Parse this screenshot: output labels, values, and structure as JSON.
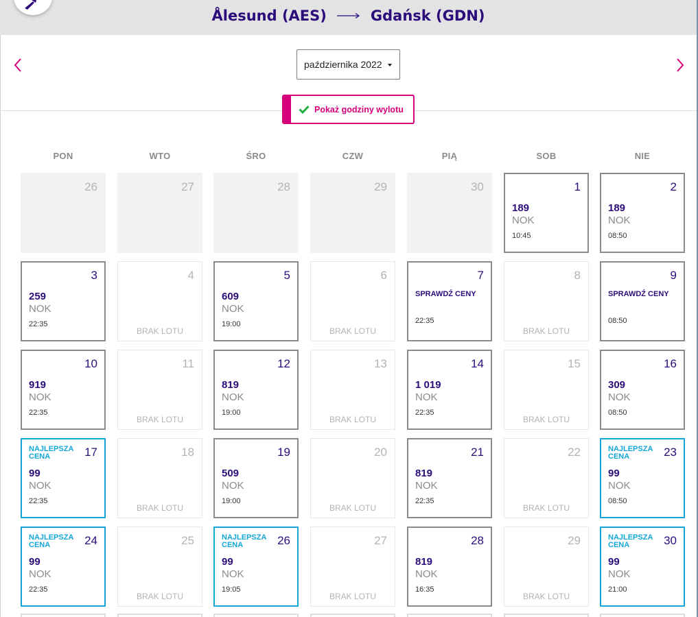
{
  "header": {
    "origin": "Ålesund (AES)",
    "destination": "Gdańsk (GDN)"
  },
  "month_select": {
    "value": "października 2022"
  },
  "toggle": {
    "label": "Pokaż godziny wylotu"
  },
  "weekdays": [
    "PON",
    "WTO",
    "ŚRO",
    "CZW",
    "PIĄ",
    "SOB",
    "NIE"
  ],
  "labels": {
    "no_flight": "BRAK LOTU",
    "check_prices": "SPRAWDŹ CENY",
    "best_price": "NAJLEPSZA CENA",
    "currency": "NOK"
  },
  "colors": {
    "brand_navy": "#2b0c7a",
    "accent_pink": "#d6007a",
    "best_blue": "#12a7d8"
  },
  "days": [
    {
      "day": "26",
      "state": "outside"
    },
    {
      "day": "27",
      "state": "outside"
    },
    {
      "day": "28",
      "state": "outside"
    },
    {
      "day": "29",
      "state": "outside"
    },
    {
      "day": "30",
      "state": "outside"
    },
    {
      "day": "1",
      "state": "flight",
      "price": "189",
      "currency": "NOK",
      "time": "10:45"
    },
    {
      "day": "2",
      "state": "flight",
      "price": "189",
      "currency": "NOK",
      "time": "08:50"
    },
    {
      "day": "3",
      "state": "flight",
      "price": "259",
      "currency": "NOK",
      "time": "22:35"
    },
    {
      "day": "4",
      "state": "no_flight"
    },
    {
      "day": "5",
      "state": "flight",
      "price": "609",
      "currency": "NOK",
      "time": "19:00"
    },
    {
      "day": "6",
      "state": "no_flight"
    },
    {
      "day": "7",
      "state": "check",
      "time": "22:35"
    },
    {
      "day": "8",
      "state": "no_flight"
    },
    {
      "day": "9",
      "state": "check",
      "time": "08:50"
    },
    {
      "day": "10",
      "state": "flight",
      "price": "919",
      "currency": "NOK",
      "time": "22:35"
    },
    {
      "day": "11",
      "state": "no_flight"
    },
    {
      "day": "12",
      "state": "flight",
      "price": "819",
      "currency": "NOK",
      "time": "19:00"
    },
    {
      "day": "13",
      "state": "no_flight"
    },
    {
      "day": "14",
      "state": "flight",
      "price": "1 019",
      "currency": "NOK",
      "time": "22:35"
    },
    {
      "day": "15",
      "state": "no_flight"
    },
    {
      "day": "16",
      "state": "flight",
      "price": "309",
      "currency": "NOK",
      "time": "08:50"
    },
    {
      "day": "17",
      "state": "best",
      "price": "99",
      "currency": "NOK",
      "time": "22:35"
    },
    {
      "day": "18",
      "state": "no_flight"
    },
    {
      "day": "19",
      "state": "flight",
      "price": "509",
      "currency": "NOK",
      "time": "19:00"
    },
    {
      "day": "20",
      "state": "no_flight"
    },
    {
      "day": "21",
      "state": "flight",
      "price": "819",
      "currency": "NOK",
      "time": "22:35"
    },
    {
      "day": "22",
      "state": "no_flight"
    },
    {
      "day": "23",
      "state": "best",
      "price": "99",
      "currency": "NOK",
      "time": "08:50"
    },
    {
      "day": "24",
      "state": "best",
      "price": "99",
      "currency": "NOK",
      "time": "22:35"
    },
    {
      "day": "25",
      "state": "no_flight"
    },
    {
      "day": "26",
      "state": "best",
      "price": "99",
      "currency": "NOK",
      "time": "19:05"
    },
    {
      "day": "27",
      "state": "no_flight"
    },
    {
      "day": "28",
      "state": "flight",
      "price": "819",
      "currency": "NOK",
      "time": "16:35"
    },
    {
      "day": "29",
      "state": "no_flight"
    },
    {
      "day": "30",
      "state": "best",
      "price": "99",
      "currency": "NOK",
      "time": "21:00"
    }
  ]
}
